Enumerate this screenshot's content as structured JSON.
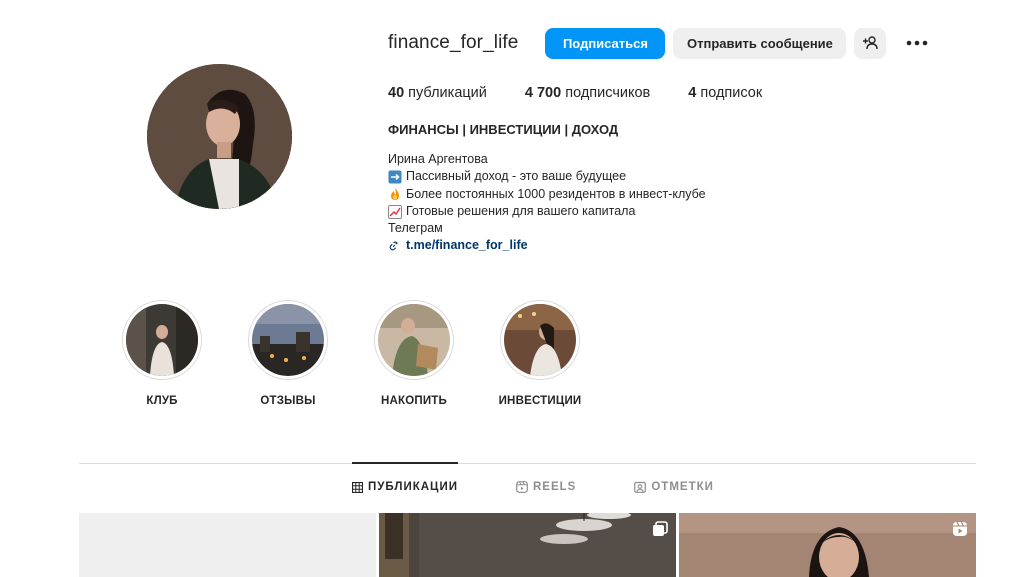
{
  "profile": {
    "username": "finance_for_life",
    "follow_label": "Подписаться",
    "message_label": "Отправить сообщение",
    "add_user_icon": "person-plus-icon",
    "more_icon": "more-horizontal-icon"
  },
  "stats": {
    "posts_count": "40",
    "posts_label": "публикаций",
    "followers_count": "4 700",
    "followers_label": "подписчиков",
    "following_count": "4",
    "following_label": "подписок"
  },
  "bio": {
    "title": "ФИНАНСЫ | ИНВЕСТИЦИИ | ДОХОД",
    "name": "Ирина Аргентова",
    "line1": "Пассивный доход - это ваше будущее",
    "line2": "Более постоянных 1000 резидентов в инвест-клубе",
    "line3": "Готовые решения для вашего капитала",
    "line4": "Телеграм",
    "link": "t.me/finance_for_life"
  },
  "highlights": [
    {
      "label": "КЛУБ"
    },
    {
      "label": "ОТЗЫВЫ"
    },
    {
      "label": "НАКОПИТЬ"
    },
    {
      "label": "ИНВЕСТИЦИИ"
    }
  ],
  "tabs": {
    "posts": "ПУБЛИКАЦИИ",
    "reels": "REELS",
    "tagged": "ОТМЕТКИ"
  },
  "colors": {
    "primary": "#0095f6",
    "link": "#00376b",
    "secondary_button": "#efefef"
  }
}
